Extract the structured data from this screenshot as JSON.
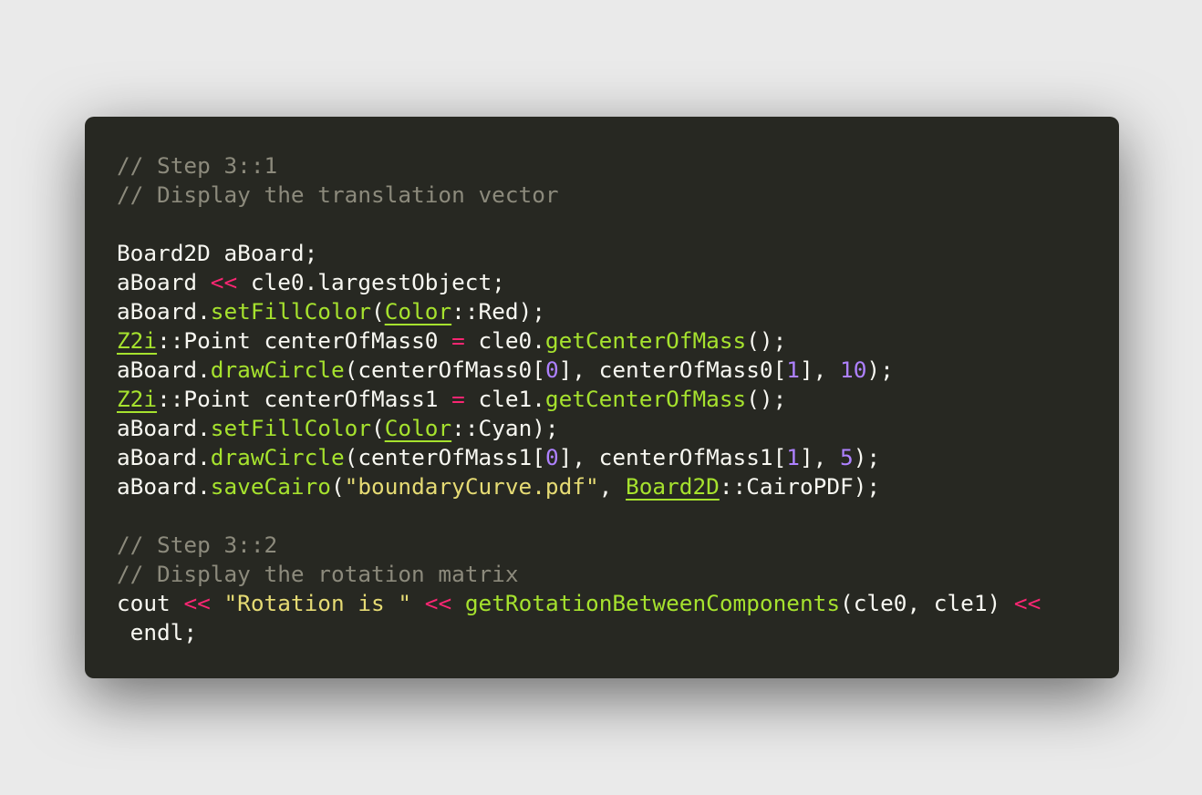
{
  "colors": {
    "background": "#eaeaea",
    "editor_background": "#272822",
    "plain": "#f8f8f2",
    "comment": "#8c8a7c",
    "operator": "#f92672",
    "function": "#a6e22e",
    "type": "#a6e22e",
    "number": "#ae81ff",
    "string": "#e6db74"
  },
  "code_lines": [
    [
      {
        "t": "comment",
        "v": "// Step 3::1"
      }
    ],
    [
      {
        "t": "comment",
        "v": "// Display the translation vector"
      }
    ],
    [],
    [
      {
        "t": "plain",
        "v": "Board2D aBoard;"
      }
    ],
    [
      {
        "t": "plain",
        "v": "aBoard "
      },
      {
        "t": "op",
        "v": "<<"
      },
      {
        "t": "plain",
        "v": " cle0.largestObject;"
      }
    ],
    [
      {
        "t": "plain",
        "v": "aBoard."
      },
      {
        "t": "func",
        "v": "setFillColor"
      },
      {
        "t": "plain",
        "v": "("
      },
      {
        "t": "type",
        "v": "Color"
      },
      {
        "t": "plain",
        "v": "::Red);"
      }
    ],
    [
      {
        "t": "type",
        "v": "Z2i"
      },
      {
        "t": "plain",
        "v": "::Point centerOfMass0 "
      },
      {
        "t": "op",
        "v": "="
      },
      {
        "t": "plain",
        "v": " cle0."
      },
      {
        "t": "func",
        "v": "getCenterOfMass"
      },
      {
        "t": "plain",
        "v": "();"
      }
    ],
    [
      {
        "t": "plain",
        "v": "aBoard."
      },
      {
        "t": "func",
        "v": "drawCircle"
      },
      {
        "t": "plain",
        "v": "(centerOfMass0["
      },
      {
        "t": "num",
        "v": "0"
      },
      {
        "t": "plain",
        "v": "], centerOfMass0["
      },
      {
        "t": "num",
        "v": "1"
      },
      {
        "t": "plain",
        "v": "], "
      },
      {
        "t": "num",
        "v": "10"
      },
      {
        "t": "plain",
        "v": ");"
      }
    ],
    [
      {
        "t": "type",
        "v": "Z2i"
      },
      {
        "t": "plain",
        "v": "::Point centerOfMass1 "
      },
      {
        "t": "op",
        "v": "="
      },
      {
        "t": "plain",
        "v": " cle1."
      },
      {
        "t": "func",
        "v": "getCenterOfMass"
      },
      {
        "t": "plain",
        "v": "();"
      }
    ],
    [
      {
        "t": "plain",
        "v": "aBoard."
      },
      {
        "t": "func",
        "v": "setFillColor"
      },
      {
        "t": "plain",
        "v": "("
      },
      {
        "t": "type",
        "v": "Color"
      },
      {
        "t": "plain",
        "v": "::Cyan);"
      }
    ],
    [
      {
        "t": "plain",
        "v": "aBoard."
      },
      {
        "t": "func",
        "v": "drawCircle"
      },
      {
        "t": "plain",
        "v": "(centerOfMass1["
      },
      {
        "t": "num",
        "v": "0"
      },
      {
        "t": "plain",
        "v": "], centerOfMass1["
      },
      {
        "t": "num",
        "v": "1"
      },
      {
        "t": "plain",
        "v": "], "
      },
      {
        "t": "num",
        "v": "5"
      },
      {
        "t": "plain",
        "v": ");"
      }
    ],
    [
      {
        "t": "plain",
        "v": "aBoard."
      },
      {
        "t": "func",
        "v": "saveCairo"
      },
      {
        "t": "plain",
        "v": "("
      },
      {
        "t": "string",
        "v": "\"boundaryCurve.pdf\""
      },
      {
        "t": "plain",
        "v": ", "
      },
      {
        "t": "type",
        "v": "Board2D"
      },
      {
        "t": "plain",
        "v": "::CairoPDF);"
      }
    ],
    [],
    [
      {
        "t": "comment",
        "v": "// Step 3::2"
      }
    ],
    [
      {
        "t": "comment",
        "v": "// Display the rotation matrix"
      }
    ],
    [
      {
        "t": "plain",
        "v": "cout "
      },
      {
        "t": "op",
        "v": "<<"
      },
      {
        "t": "plain",
        "v": " "
      },
      {
        "t": "string",
        "v": "\"Rotation is \""
      },
      {
        "t": "plain",
        "v": " "
      },
      {
        "t": "op",
        "v": "<<"
      },
      {
        "t": "plain",
        "v": " "
      },
      {
        "t": "func",
        "v": "getRotationBetweenComponents"
      },
      {
        "t": "plain",
        "v": "(cle0, cle1) "
      },
      {
        "t": "op",
        "v": "<<"
      }
    ],
    [
      {
        "t": "plain",
        "v": " endl;"
      }
    ]
  ]
}
